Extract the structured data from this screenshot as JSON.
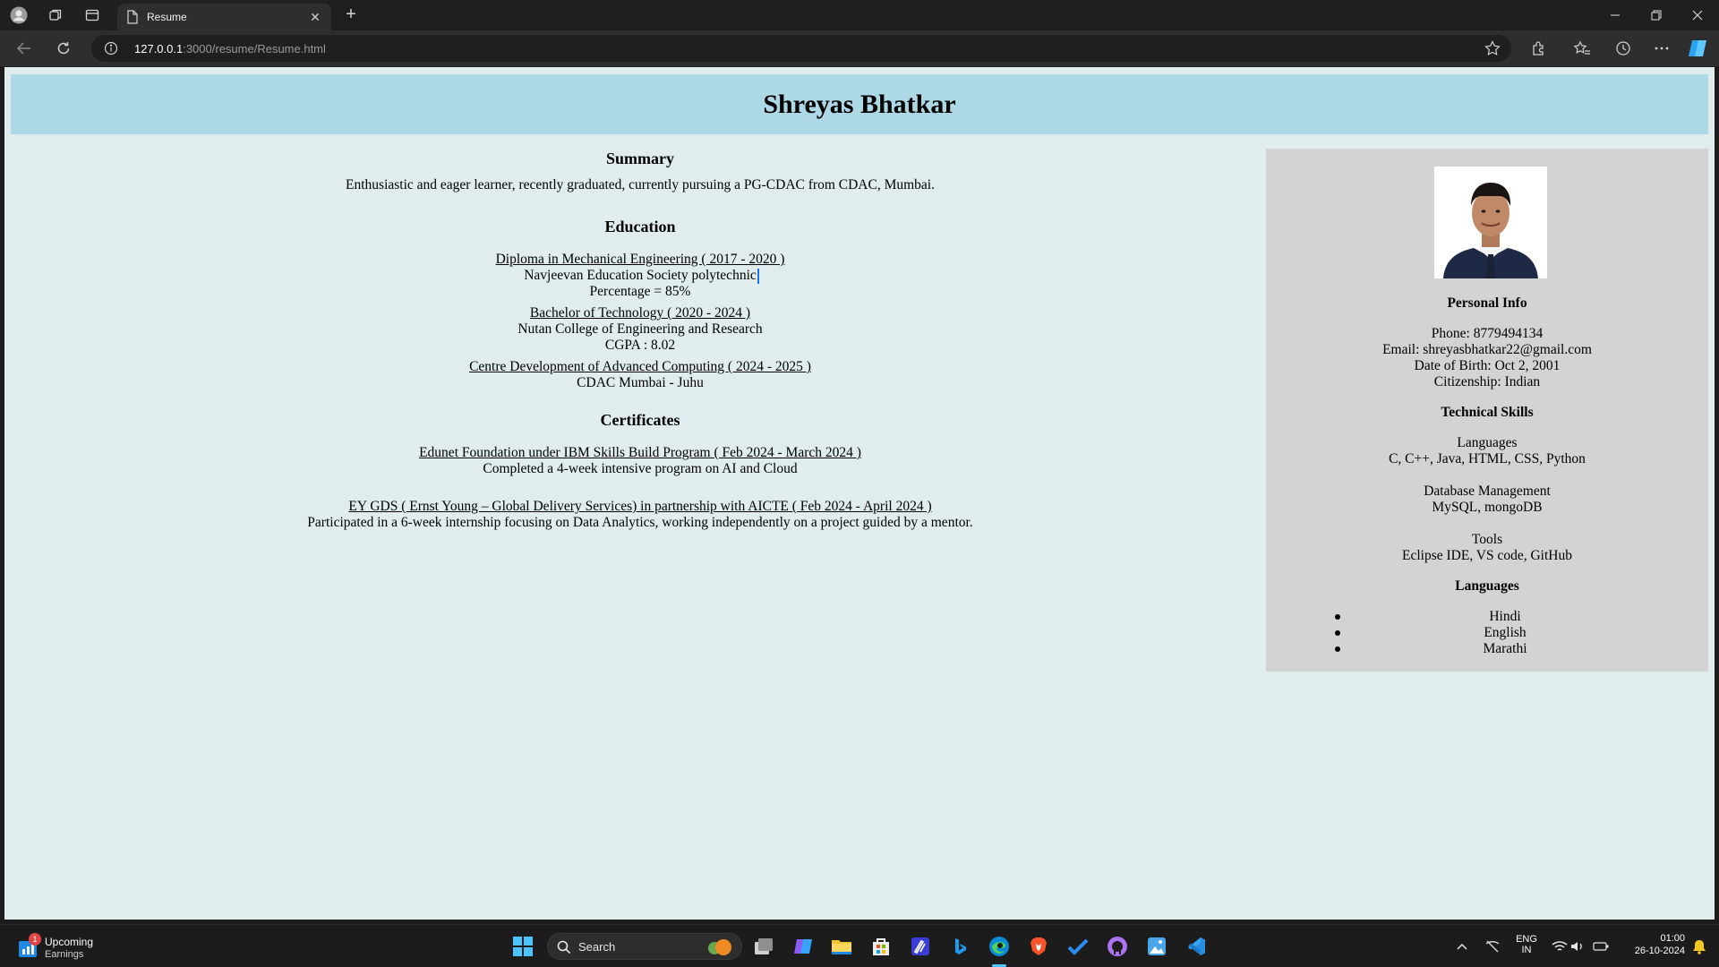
{
  "browser": {
    "tab_title": "Resume",
    "url_host": "127.0.0.1",
    "url_rest": ":3000/resume/Resume.html"
  },
  "page": {
    "name": "Shreyas Bhatkar",
    "summary": {
      "heading": "Summary",
      "text": "Enthusiastic and eager learner, recently graduated, currently pursuing a PG-CDAC from CDAC, Mumbai."
    },
    "education": {
      "heading": "Education",
      "items": [
        {
          "title": "Diploma in Mechanical Engineering ( 2017 - 2020 )",
          "line1": "Navjeevan Education Society polytechnic",
          "line2": "Percentage = 85%"
        },
        {
          "title": "Bachelor of Technology ( 2020 - 2024 )",
          "line1": "Nutan College of Engineering and Research",
          "line2": "CGPA : 8.02"
        },
        {
          "title": "Centre Development of Advanced Computing ( 2024 - 2025 )",
          "line1": "CDAC Mumbai - Juhu",
          "line2": ""
        }
      ]
    },
    "certificates": {
      "heading": "Certificates",
      "items": [
        {
          "title": "Edunet Foundation under IBM Skills Build Program ( Feb 2024 - March 2024 )",
          "desc": "Completed a 4-week intensive program on AI and Cloud"
        },
        {
          "title": "EY GDS ( Ernst Young – Global Delivery Services) in partnership with AICTE ( Feb 2024 - April 2024 )",
          "desc": "Participated in a 6-week internship focusing on Data Analytics, working independently on a project guided by a mentor."
        }
      ]
    },
    "sidebar": {
      "personal_heading": "Personal Info",
      "phone": "Phone: 8779494134",
      "email": "Email: shreyasbhatkar22@gmail.com",
      "dob": "Date of Birth: Oct 2, 2001",
      "citizenship": "Citizenship: Indian",
      "skills_heading": "Technical Skills",
      "skill_groups": [
        {
          "name": "Languages",
          "items": "C, C++, Java, HTML, CSS, Python"
        },
        {
          "name": "Database Management",
          "items": "MySQL, mongoDB"
        },
        {
          "name": "Tools",
          "items": "Eclipse IDE, VS code, GitHub"
        }
      ],
      "languages_heading": "Languages",
      "languages": [
        "Hindi",
        "English",
        "Marathi"
      ]
    }
  },
  "taskbar": {
    "widget_title": "Upcoming",
    "widget_sub": "Earnings",
    "widget_badge": "1",
    "search_label": "Search",
    "lang_top": "ENG",
    "lang_bottom": "IN",
    "time": "01:00",
    "date": "26-10-2024"
  },
  "colors": {
    "header_bg": "#add8e6",
    "page_bg": "#e0ecee",
    "sidebar_bg": "#d3d3d3"
  }
}
